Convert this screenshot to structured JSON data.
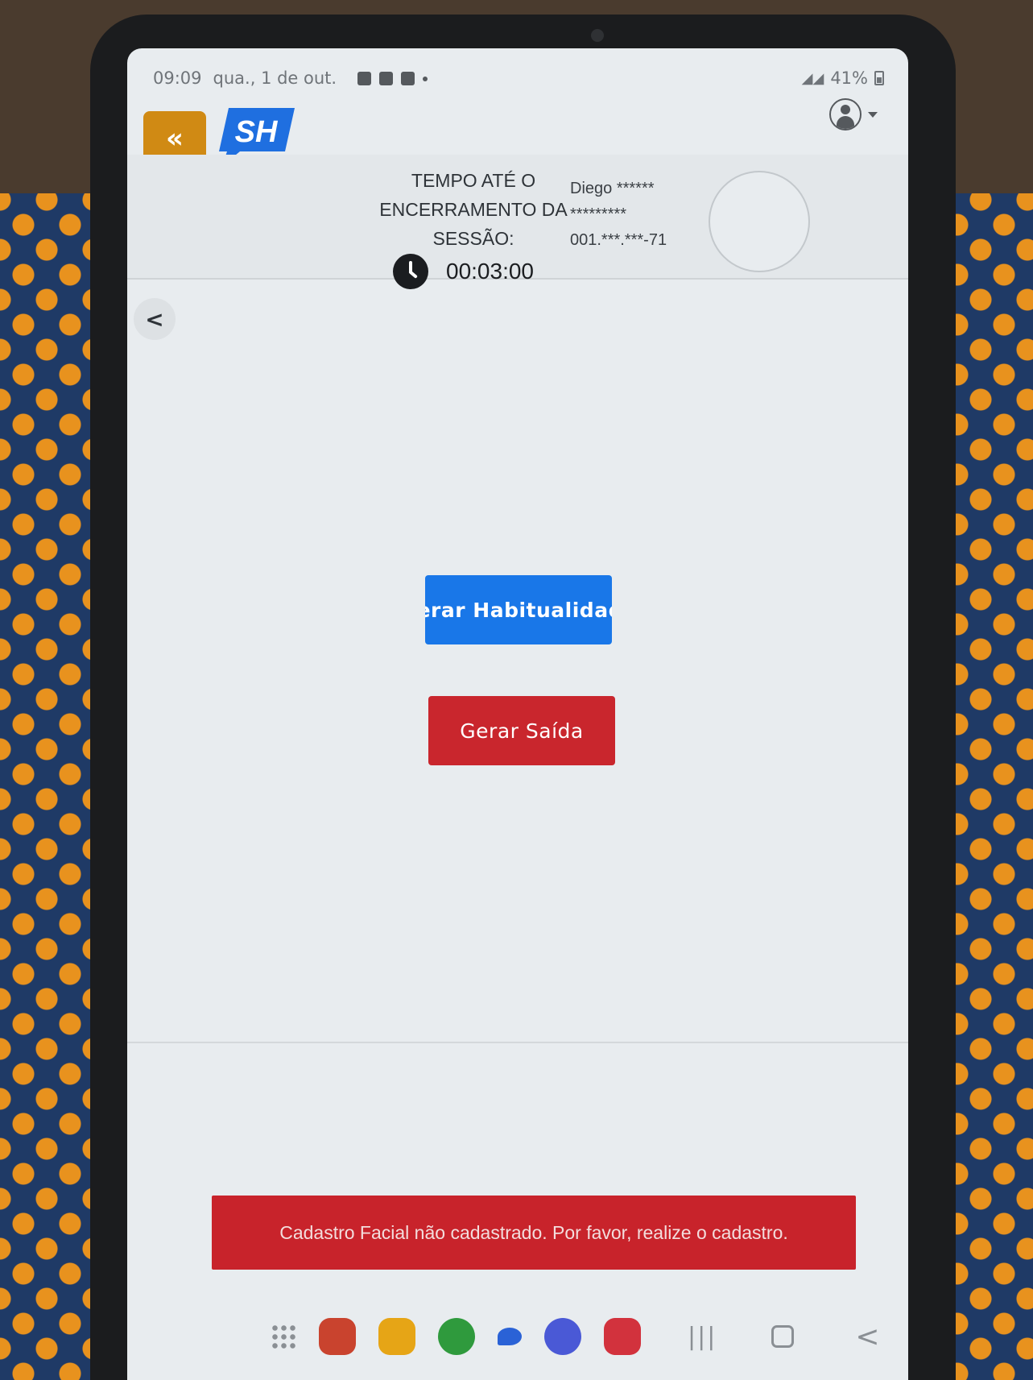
{
  "status_bar": {
    "time": "09:09",
    "date": "qua., 1 de out.",
    "battery": "41%"
  },
  "header": {
    "menu_toggle_label": "«",
    "logo_text": "SH"
  },
  "session": {
    "title_line1": "TEMPO ATÉ O",
    "title_line2": "ENCERRAMENTO DA",
    "title_line3": "SESSÃO:",
    "timer": "00:03:00",
    "user_name": "Diego ******",
    "user_surname": "*********",
    "user_document": "001.***.***-71"
  },
  "navigation": {
    "back_label": "<"
  },
  "actions": {
    "habitualidade_label": "Gerar Habitualidade",
    "saida_label": "Gerar Saída"
  },
  "toast": {
    "message": "Cadastro Facial não cadastrado. Por favor, realize o cadastro."
  },
  "system_nav": {
    "recent_label": "|||",
    "back_label": "<"
  },
  "colors": {
    "accent_orange": "#d08a14",
    "primary_blue": "#1977e8",
    "danger_red": "#c9262d",
    "logo_blue": "#1f6fe0"
  },
  "icons": {
    "clock": "clock-icon",
    "user": "user-avatar-icon"
  }
}
